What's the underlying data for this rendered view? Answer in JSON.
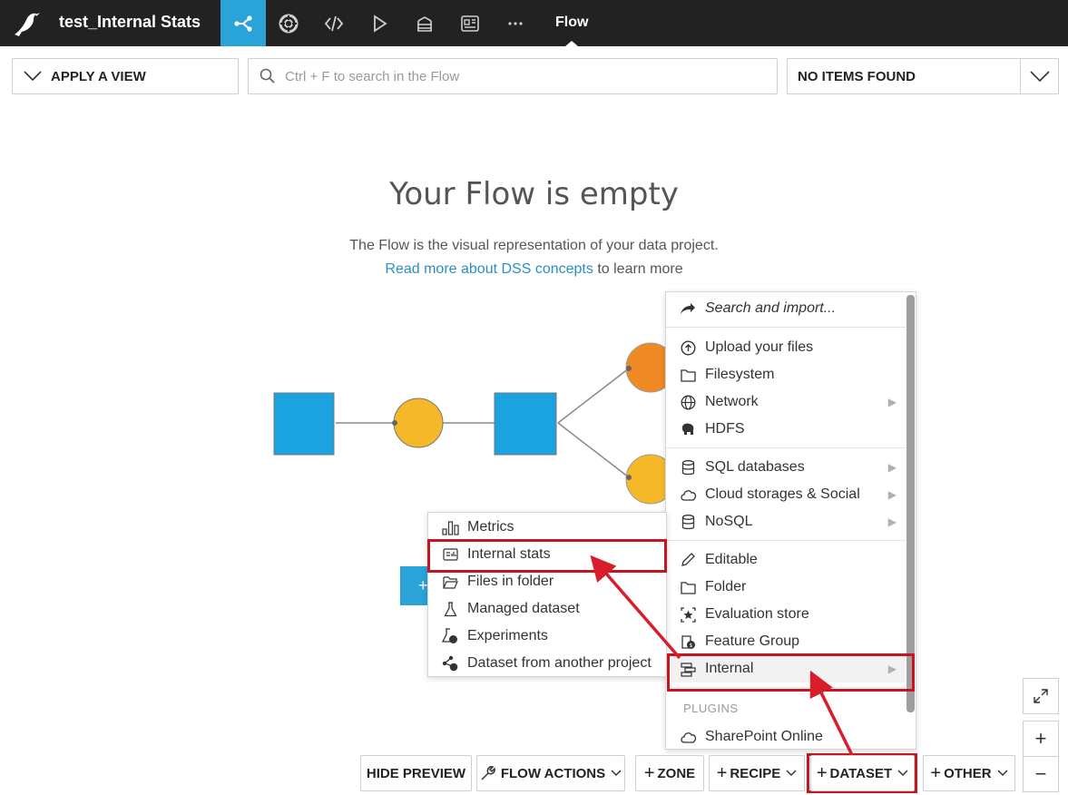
{
  "topbar": {
    "project_title": "test_Internal Stats",
    "active_tab": "Flow",
    "icons": [
      "flow-icon",
      "lifecycle-icon",
      "code-icon",
      "run-icon",
      "stack-icon",
      "dashboard-icon",
      "more-icon"
    ]
  },
  "filters": {
    "view_label": "APPLY A VIEW",
    "search_placeholder": "Ctrl + F to search in the Flow",
    "items_label": "NO ITEMS FOUND"
  },
  "empty_state": {
    "title": "Your Flow is empty",
    "description": "The Flow is the visual representation of your data project.",
    "link_text": "Read more about DSS concepts",
    "link_suffix": " to learn more"
  },
  "dataset_menu": {
    "items": [
      {
        "label": "Search and import...",
        "icon": "share-arrow-icon"
      },
      {
        "label": "Upload your files",
        "icon": "upload-icon"
      },
      {
        "label": "Filesystem",
        "icon": "folder-icon"
      },
      {
        "label": "Network",
        "icon": "globe-icon",
        "submenu": true
      },
      {
        "label": "HDFS",
        "icon": "elephant-icon"
      },
      {
        "label": "SQL databases",
        "icon": "database-icon",
        "submenu": true
      },
      {
        "label": "Cloud storages & Social",
        "icon": "cloud-icon",
        "submenu": true
      },
      {
        "label": "NoSQL",
        "icon": "nosql-icon",
        "submenu": true
      },
      {
        "label": "Editable",
        "icon": "pencil-icon"
      },
      {
        "label": "Folder",
        "icon": "folder-icon"
      },
      {
        "label": "Evaluation store",
        "icon": "star-box-icon"
      },
      {
        "label": "Feature Group",
        "icon": "feature-group-icon"
      },
      {
        "label": "Internal",
        "icon": "internal-icon",
        "submenu": true
      }
    ],
    "plugins_header": "PLUGINS",
    "plugin_items": [
      {
        "label": "SharePoint Online",
        "icon": "cloud-icon"
      }
    ]
  },
  "internal_submenu": {
    "items": [
      {
        "label": "Metrics",
        "icon": "metrics-icon"
      },
      {
        "label": "Internal stats",
        "icon": "stats-icon"
      },
      {
        "label": "Files in folder",
        "icon": "folder-open-icon"
      },
      {
        "label": "Managed dataset",
        "icon": "flask-icon"
      },
      {
        "label": "Experiments",
        "icon": "experiments-icon"
      },
      {
        "label": "Dataset from another project",
        "icon": "shared-dataset-icon"
      }
    ]
  },
  "toolbar": {
    "hide_preview": "HIDE PREVIEW",
    "flow_actions": "FLOW ACTIONS",
    "zone": "ZONE",
    "recipe": "RECIPE",
    "dataset": "DATASET",
    "other": "OTHER",
    "zoom_in": "+",
    "zoom_out": "−"
  },
  "colors": {
    "topbar": "#222222",
    "accent": "#29a3d8",
    "dataset_blue": "#1aa3e0",
    "recipe_yellow": "#f5b829",
    "recipe_orange": "#f08a24",
    "highlight_red": "#c8141e",
    "link": "#2b8fc4"
  }
}
